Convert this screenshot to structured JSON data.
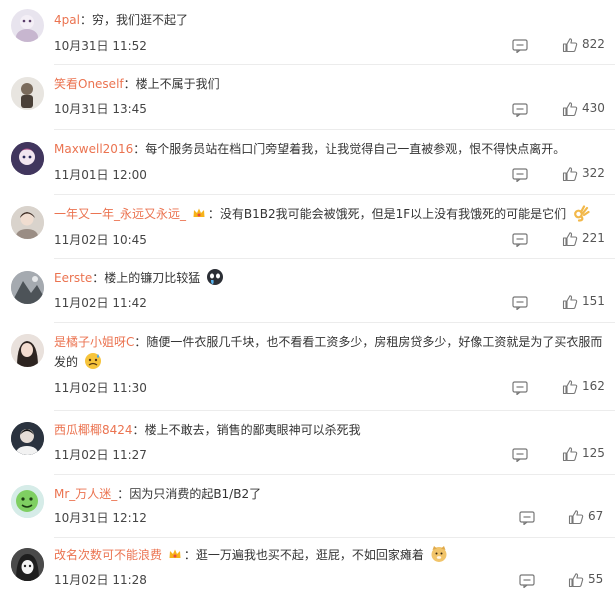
{
  "comments": [
    {
      "user": "4pal",
      "text": "穷，我们逛不起了",
      "time": "10月31日 11:52",
      "likes": "822"
    },
    {
      "user": "笑看Oneself",
      "text": "楼上不属于我们",
      "time": "10月31日 13:45",
      "likes": "430"
    },
    {
      "user": "Maxwell2016",
      "text": "每个服务员站在档口门旁望着我，让我觉得自己一直被参观，恨不得快点离开。",
      "time": "11月01日 12:00",
      "likes": "322"
    },
    {
      "user": "一年又一年_永远又永远_",
      "text": "没有B1B2我可能会被饿死，但是1F以上没有我饿死的可能是它们",
      "time": "11月02日 10:45",
      "likes": "221"
    },
    {
      "user": "Eerste",
      "text": "楼上的镰刀比较猛",
      "time": "11月02日 11:42",
      "likes": "151"
    },
    {
      "user": "是橘子小姐呀C",
      "text": "随便一件衣服几千块，也不看看工资多少，房租房贷多少，好像工资就是为了买衣服而发的",
      "time": "11月02日 11:30",
      "likes": "162"
    },
    {
      "user": "西瓜椰椰8424",
      "text": "楼上不敢去，销售的鄙夷眼神可以杀死我",
      "time": "11月02日 11:27",
      "likes": "125"
    },
    {
      "user": "Mr_万人迷_",
      "text": "因为只消费的起B1/B2了",
      "time": "10月31日 12:12",
      "likes": "67"
    },
    {
      "user": "改名次数可不能浪费",
      "text": "逛一万遍我也买不起，逛屁，不如回家瘫着",
      "time": "11月02日 11:28",
      "likes": "55"
    }
  ],
  "colors": {
    "username": "#eb7350",
    "text": "#333333",
    "meta": "#555555"
  },
  "icons": {
    "reply": "comment-icon",
    "like": "thumbs-up-icon"
  }
}
